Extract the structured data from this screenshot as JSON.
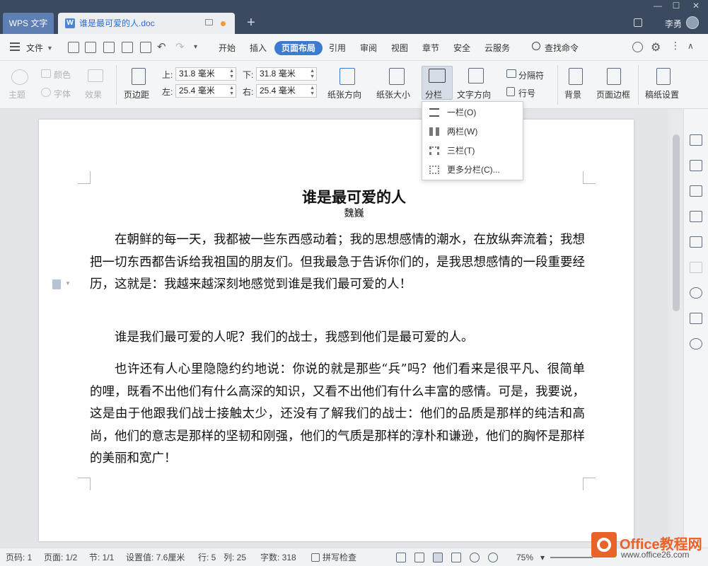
{
  "window": {
    "app_tab": "WPS 文字",
    "doc_tab": "谁是最可爱的人.doc",
    "new_tab": "+",
    "user_name": "李勇",
    "controls": {
      "min": "—",
      "max": "☐",
      "close": "✕"
    }
  },
  "menubar": {
    "file_label": "文件",
    "items": [
      "开始",
      "插入",
      "页面布局",
      "引用",
      "审阅",
      "视图",
      "章节",
      "安全",
      "云服务"
    ],
    "active": "页面布局",
    "search_label": "查找命令"
  },
  "ribbon": {
    "theme": "主题",
    "color": "颜色",
    "font": "字体",
    "effect": "效果",
    "margins": "页边距",
    "top_label": "上:",
    "top_value": "31.8 毫米",
    "bottom_label": "下:",
    "bottom_value": "31.8 毫米",
    "left_label": "左:",
    "left_value": "25.4 毫米",
    "right_label": "右:",
    "right_value": "25.4 毫米",
    "orientation": "纸张方向",
    "paper_size": "纸张大小",
    "columns": "分栏",
    "text_direction": "文字方向",
    "separator": "分隔符",
    "line_numbers": "行号",
    "background": "背景",
    "page_border": "页面边框",
    "manuscript": "稿纸设置"
  },
  "columns_menu": {
    "items": [
      "一栏(O)",
      "两栏(W)",
      "三栏(T)",
      "更多分栏(C)..."
    ]
  },
  "document": {
    "title": "谁是最可爱的人",
    "author": "魏巍",
    "paragraphs": [
      "在朝鲜的每一天，我都被一些东西感动着；我的思想感情的潮水，在放纵奔流着；我想把一切东西都告诉给我祖国的朋友们。但我最急于告诉你们的，是我思想感情的一段重要经历，这就是：我越来越深刻地感觉到谁是我们最可爱的人！",
      "谁是我们最可爱的人呢？我们的战士，我感到他们是最可爱的人。",
      "也许还有人心里隐隐约约地说：你说的就是那些“兵”吗？他们看来是很平凡、很简单的哩，既看不出他们有什么高深的知识，又看不出他们有什么丰富的感情。可是，我要说，这是由于他跟我们战士接触太少，还没有了解我们的战士：他们的品质是那样的纯洁和高尚，他们的意志是那样的坚韧和刚强，他们的气质是那样的淳朴和谦逊，他们的胸怀是那样的美丽和宽广！"
    ]
  },
  "statusbar": {
    "page_num": "页码: 1",
    "pages": "页面: 1/2",
    "section": "节: 1/1",
    "setting": "设置值: 7.6厘米",
    "row": "行: 5",
    "col": "列: 25",
    "wordcount": "字数: 318",
    "spellcheck": "拼写检查",
    "zoom": "75%"
  },
  "watermark": {
    "brand": "Office教程网",
    "url": "www.office26.com"
  }
}
